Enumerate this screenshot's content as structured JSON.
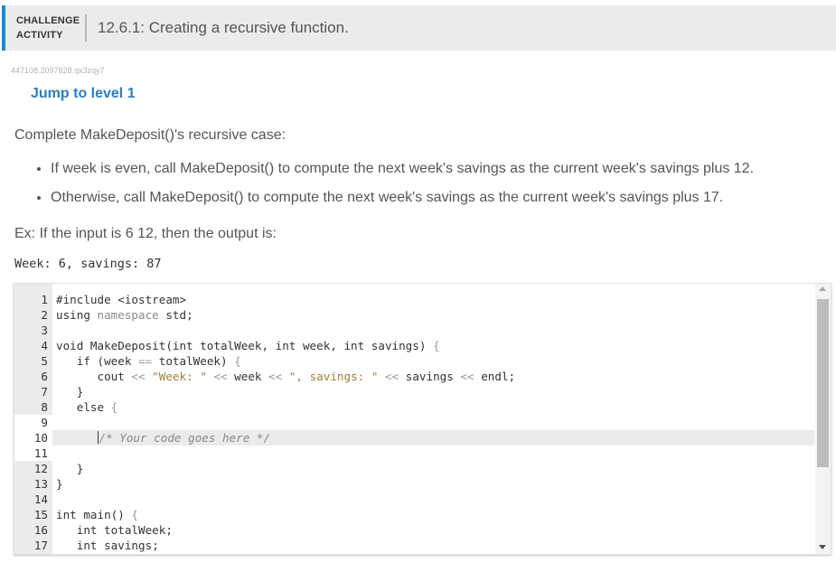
{
  "header": {
    "kind_line1": "CHALLENGE",
    "kind_line2": "ACTIVITY",
    "title": "12.6.1: Creating a recursive function.",
    "accent_color": "#1b8bd0"
  },
  "activity_id": "447108.2097828.qx3zqy7",
  "jump_link": "Jump to level 1",
  "instructions": {
    "prompt": "Complete MakeDeposit()'s recursive case:",
    "bullets": [
      "If week is even, call MakeDeposit() to compute the next week's savings as the current week's savings plus 12.",
      "Otherwise, call MakeDeposit() to compute the next week's savings as the current week's savings plus 17."
    ],
    "example": "Ex: If the input is 6 12, then the output is:",
    "example_output": "Week: 6, savings: 87"
  },
  "editor": {
    "line_numbers": [
      "1",
      "2",
      "3",
      "4",
      "5",
      "6",
      "7",
      "8",
      "9",
      "10",
      "11",
      "12",
      "13",
      "14",
      "15",
      "16",
      "17"
    ],
    "code": {
      "l1": "#include <iostream>",
      "l2a": "using ",
      "l2b": "namespace",
      "l2c": " std;",
      "l4a": "void MakeDeposit(int totalWeek, int week, int savings) ",
      "l4b": "{",
      "l5a": "   if (week ",
      "l5b": "==",
      "l5c": " totalWeek) ",
      "l5d": "{",
      "l6a": "      cout ",
      "l6b": "<<",
      "l6c": " \"Week: \"",
      "l6d": " << ",
      "l6e": "week ",
      "l6f": "<<",
      "l6g": " \", savings: \"",
      "l6h": " << ",
      "l6i": "savings ",
      "l6j": "<<",
      "l6k": " endl;",
      "l7": "   }",
      "l8a": "   else ",
      "l8b": "{",
      "l10": "/* Your code goes here */",
      "l12": "   }",
      "l13": "}",
      "l15a": "int main() ",
      "l15b": "{",
      "l16": "   int totalWeek;",
      "l17": "   int savings;"
    }
  }
}
